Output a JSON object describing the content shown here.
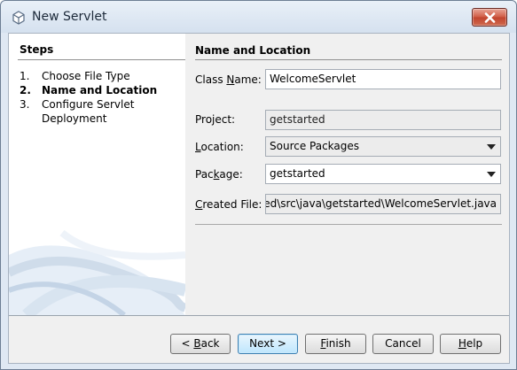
{
  "window": {
    "title": "New Servlet"
  },
  "steps": {
    "heading": "Steps",
    "items": [
      {
        "number": "1.",
        "label": "Choose File Type",
        "current": false
      },
      {
        "number": "2.",
        "label": "Name and Location",
        "current": true
      },
      {
        "number": "3.",
        "label": "Configure Servlet",
        "current": false
      }
    ],
    "item3_line2": "Deployment"
  },
  "content": {
    "heading": "Name and Location",
    "class_name": {
      "label_pre": "Class ",
      "label_mnemonic": "N",
      "label_post": "ame:",
      "value": "WelcomeServlet"
    },
    "project": {
      "label": "Project:",
      "value": "getstarted"
    },
    "location": {
      "label_pre": "",
      "label_mnemonic": "L",
      "label_post": "ocation:",
      "value": "Source Packages"
    },
    "package": {
      "label_pre": "Pac",
      "label_mnemonic": "k",
      "label_post": "age:",
      "value": "getstarted"
    },
    "created_file": {
      "label_pre": "",
      "label_mnemonic": "C",
      "label_post": "reated File:",
      "value": "ted\\src\\java\\getstarted\\WelcomeServlet.java"
    }
  },
  "buttons": {
    "back": {
      "pre": "< ",
      "mnemonic": "B",
      "post": "ack"
    },
    "next": "Next >",
    "finish": {
      "pre": "",
      "mnemonic": "F",
      "post": "inish"
    },
    "cancel": "Cancel",
    "help": {
      "pre": "",
      "mnemonic": "H",
      "post": "elp"
    }
  },
  "colors": {
    "window_frame": "#dfe8f3",
    "close_button": "#c1432d",
    "default_button": "#bee6fd"
  }
}
